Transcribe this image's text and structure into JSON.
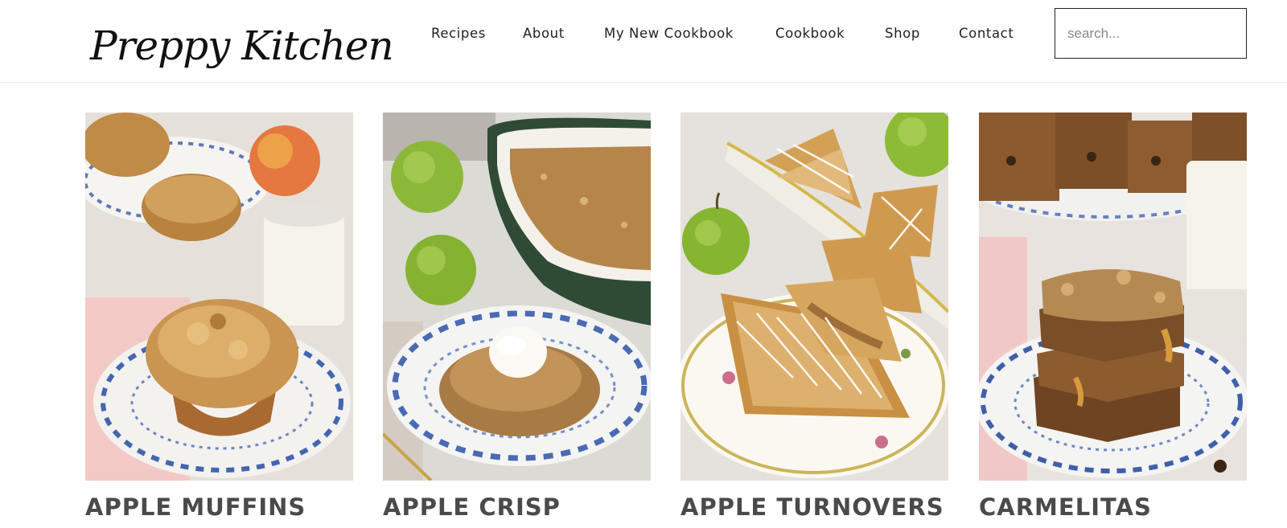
{
  "brand": {
    "logo_text": "Preppy Kitchen"
  },
  "nav": {
    "items": [
      {
        "label": "Recipes"
      },
      {
        "label": "About"
      },
      {
        "label": "My New Cookbook"
      },
      {
        "label": "Cookbook"
      },
      {
        "label": "Shop"
      },
      {
        "label": "Contact"
      }
    ]
  },
  "search": {
    "placeholder": "search..."
  },
  "recipes": [
    {
      "title": "APPLE MUFFINS",
      "image": "apple-muffins-photo"
    },
    {
      "title": "APPLE CRISP",
      "image": "apple-crisp-photo"
    },
    {
      "title": "APPLE TURNOVERS",
      "image": "apple-turnovers-photo"
    },
    {
      "title": "CARMELITAS",
      "image": "carmelitas-photo"
    }
  ],
  "colors": {
    "title_text": "#4a4a4a",
    "search_border": "#222222",
    "header_divider": "#ececec"
  }
}
